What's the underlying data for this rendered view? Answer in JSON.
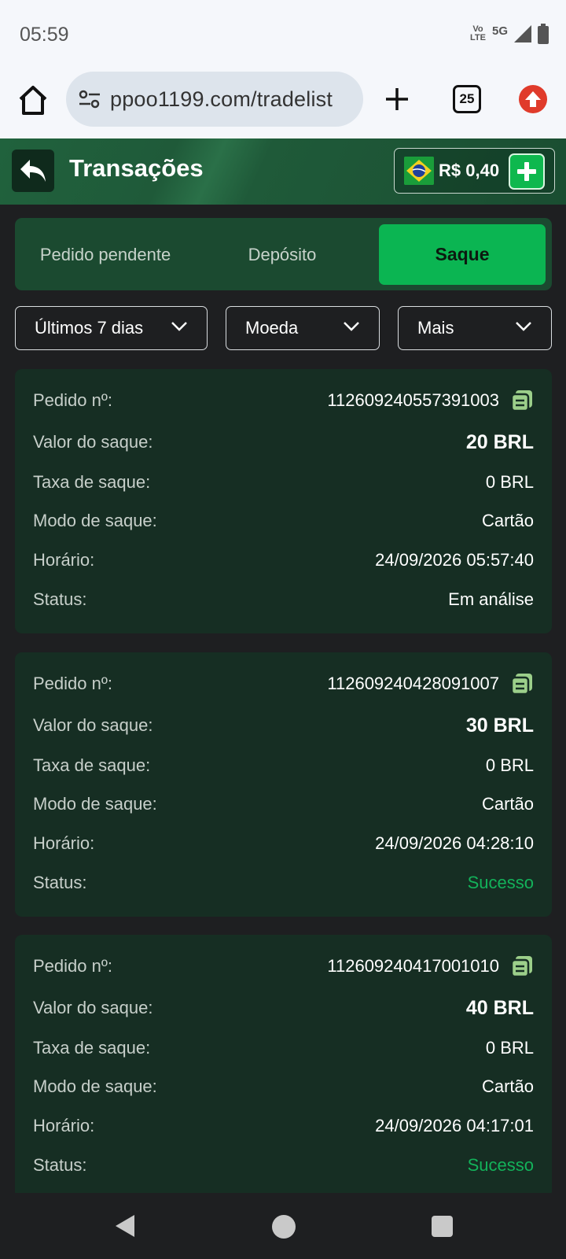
{
  "status_bar": {
    "time": "05:59",
    "volte_top": "Vo",
    "volte_bottom": "LTE",
    "network": "5G"
  },
  "browser": {
    "url": "ppoo1199.com/tradelist",
    "tab_count": "25"
  },
  "header": {
    "title": "Transações",
    "balance": "R$ 0,40"
  },
  "tabs": [
    {
      "label": "Pedido pendente",
      "active": false
    },
    {
      "label": "Depósito",
      "active": false
    },
    {
      "label": "Saque",
      "active": true
    }
  ],
  "filters": {
    "period": "Últimos 7 dias",
    "currency": "Moeda",
    "more": "Mais"
  },
  "labels": {
    "order": "Pedido nº:",
    "amount": "Valor do saque:",
    "fee": "Taxa de saque:",
    "mode": "Modo de saque:",
    "time": "Horário:",
    "status": "Status:"
  },
  "transactions": [
    {
      "order_no": "1126092405573910​03",
      "amount": "20 BRL",
      "fee": "0 BRL",
      "mode": "Cartão",
      "time": "24/09/2026 05:57:40",
      "status": "Em análise"
    },
    {
      "order_no": "112609240428091007",
      "amount": "30 BRL",
      "fee": "0 BRL",
      "mode": "Cartão",
      "time": "24/09/2026 04:28:10",
      "status": "Sucesso"
    },
    {
      "order_no": "112609240417001010",
      "amount": "40 BRL",
      "fee": "0 BRL",
      "mode": "Cartão",
      "time": "24/09/2026 04:17:01",
      "status": "Sucesso"
    }
  ],
  "colors": {
    "accent": "#0bb552",
    "success": "#13b25a",
    "card_bg": "#162e23",
    "header_bg": "#1f5a39"
  }
}
